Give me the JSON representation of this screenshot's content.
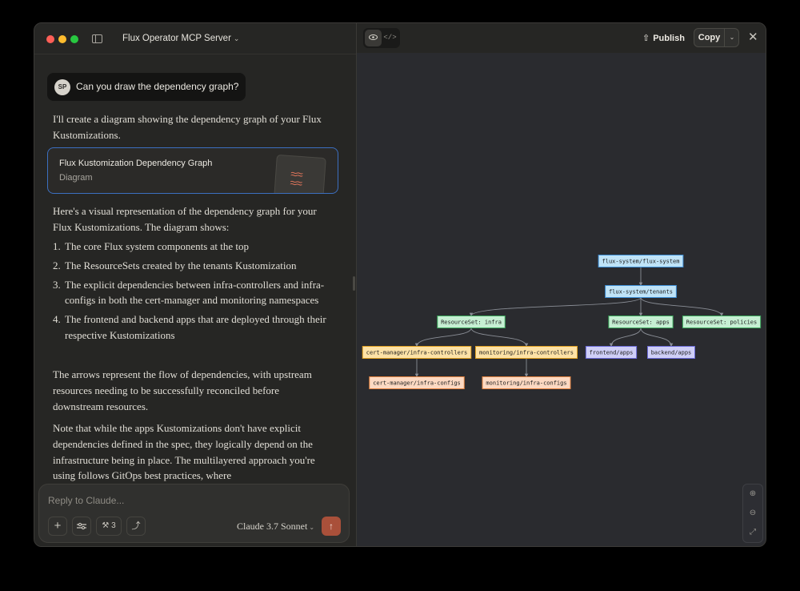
{
  "window": {
    "project_title": "Flux Operator MCP Server"
  },
  "chat": {
    "user": {
      "initials": "SP",
      "message": "Can you draw the dependency graph?"
    },
    "intro": "I'll create a diagram showing the dependency graph of your Flux Kustomizations.",
    "artifact_card": {
      "title": "Flux Kustomization Dependency Graph",
      "type": "Diagram"
    },
    "explanation": "Here's a visual representation of the dependency graph for your Flux Kustomizations. The diagram shows:",
    "list": [
      {
        "num": "1.",
        "text": "The core Flux system components at the top"
      },
      {
        "num": "2.",
        "text": "The ResourceSets created by the tenants Kustomization"
      },
      {
        "num": "3.",
        "text": "The explicit dependencies between infra-controllers and infra-configs in both the cert-manager and monitoring namespaces"
      },
      {
        "num": "4.",
        "text": "The frontend and backend apps that are deployed through their respective Kustomizations"
      }
    ],
    "arrows_note": "The arrows represent the flow of dependencies, with upstream resources needing to be successfully reconciled before downstream resources.",
    "note": "Note that while the apps Kustomizations don't have explicit dependencies defined in the spec, they logically depend on the infrastructure being in place. The multilayered approach you're using follows GitOps best practices, where"
  },
  "composer": {
    "placeholder": "Reply to Claude...",
    "tools_count": "3",
    "model": "Claude 3.7 Sonnet"
  },
  "artifact_pane": {
    "publish_label": "Publish",
    "copy_label": "Copy"
  },
  "graph": {
    "nodes": [
      {
        "id": "flux",
        "label": "flux-system/flux-system",
        "kind": "flux"
      },
      {
        "id": "tenants",
        "label": "flux-system/tenants",
        "kind": "flux"
      },
      {
        "id": "rs-infra",
        "label": "ResourceSet: infra",
        "kind": "resourceset"
      },
      {
        "id": "rs-apps",
        "label": "ResourceSet: apps",
        "kind": "resourceset"
      },
      {
        "id": "rs-policies",
        "label": "ResourceSet: policies",
        "kind": "resourceset"
      },
      {
        "id": "cm-ctrl",
        "label": "cert-manager/infra-controllers",
        "kind": "controller"
      },
      {
        "id": "mon-ctrl",
        "label": "monitoring/infra-controllers",
        "kind": "controller"
      },
      {
        "id": "frontend",
        "label": "frontend/apps",
        "kind": "app"
      },
      {
        "id": "backend",
        "label": "backend/apps",
        "kind": "app"
      },
      {
        "id": "cm-cfg",
        "label": "cert-manager/infra-configs",
        "kind": "config"
      },
      {
        "id": "mon-cfg",
        "label": "monitoring/infra-configs",
        "kind": "config"
      }
    ],
    "edges": [
      [
        "flux",
        "tenants"
      ],
      [
        "tenants",
        "rs-infra"
      ],
      [
        "tenants",
        "rs-apps"
      ],
      [
        "tenants",
        "rs-policies"
      ],
      [
        "rs-infra",
        "cm-ctrl"
      ],
      [
        "rs-infra",
        "mon-ctrl"
      ],
      [
        "rs-apps",
        "frontend"
      ],
      [
        "rs-apps",
        "backend"
      ],
      [
        "cm-ctrl",
        "cm-cfg"
      ],
      [
        "mon-ctrl",
        "mon-cfg"
      ]
    ],
    "colors": {
      "flux": {
        "fill": "#bfe3f7",
        "stroke": "#3f8fd6"
      },
      "resourceset": {
        "fill": "#c6efd3",
        "stroke": "#3aa65a"
      },
      "controller": {
        "fill": "#fde2a6",
        "stroke": "#e0a020"
      },
      "app": {
        "fill": "#cfcff7",
        "stroke": "#6a6ad8"
      },
      "config": {
        "fill": "#fcd9c2",
        "stroke": "#e3823f"
      },
      "edge": "#8a8e96",
      "background": "#2a2b2f"
    }
  }
}
